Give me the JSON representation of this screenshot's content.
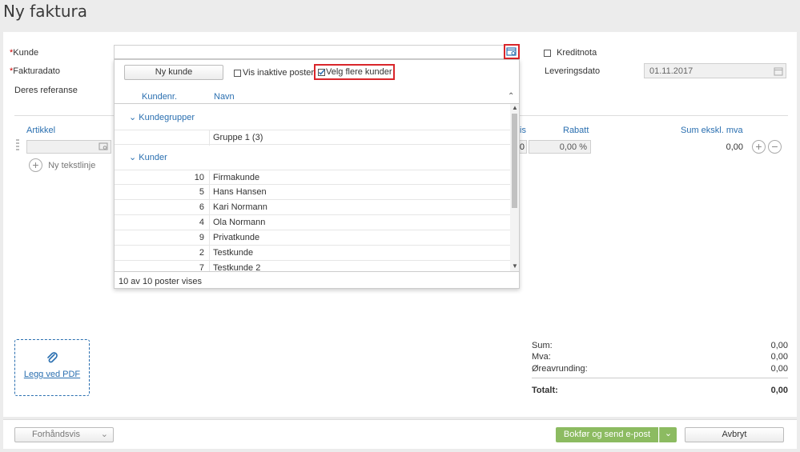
{
  "page": {
    "title": "Ny faktura"
  },
  "form": {
    "kunde_label": "Kunde",
    "fakturadato_label": "Fakturadato",
    "deres_referanse_label": "Deres referanse",
    "kreditnota_label": "Kreditnota",
    "leveringsdato_label": "Leveringsdato",
    "leveringsdato_value": "01.11.2017",
    "required_marker": "*"
  },
  "dropdown": {
    "new_customer_button": "Ny kunde",
    "show_inactive_label": "Vis inaktive poster",
    "select_multiple_label": "Velg flere kunder",
    "columns": {
      "number": "Kundenr.",
      "name": "Navn"
    },
    "groups_header": "Kundegrupper",
    "groups": [
      {
        "number": "",
        "name": "Gruppe 1 (3)"
      }
    ],
    "customers_header": "Kunder",
    "customers": [
      {
        "number": "10",
        "name": "Firmakunde"
      },
      {
        "number": "5",
        "name": "Hans Hansen"
      },
      {
        "number": "6",
        "name": "Kari Normann"
      },
      {
        "number": "4",
        "name": "Ola Normann"
      },
      {
        "number": "9",
        "name": "Privatkunde"
      },
      {
        "number": "2",
        "name": "Testkunde"
      },
      {
        "number": "7",
        "name": "Testkunde 2"
      }
    ],
    "footer": "10 av 10 poster vises"
  },
  "lines": {
    "col_artikkel": "Artikkel",
    "col_pris_partial": "is",
    "col_rabatt": "Rabatt",
    "col_sum": "Sum ekskl. mva",
    "row_price_partial": "0",
    "row_rabatt": "0,00 %",
    "row_sum": "0,00",
    "add_text_line": "Ny tekstlinje"
  },
  "attach": {
    "label": "Legg ved PDF"
  },
  "totals": {
    "sum_label": "Sum:",
    "sum_value": "0,00",
    "mva_label": "Mva:",
    "mva_value": "0,00",
    "rounding_label": "Øreavrunding:",
    "rounding_value": "0,00",
    "total_label": "Totalt:",
    "total_value": "0,00"
  },
  "footer": {
    "preview_button": "Forhåndsvis",
    "post_send_button": "Bokfør og send e-post",
    "cancel_button": "Avbryt"
  },
  "colors": {
    "accent": "#2a6fb0",
    "primary_button": "#8cbb61",
    "highlight": "#d9252a"
  }
}
